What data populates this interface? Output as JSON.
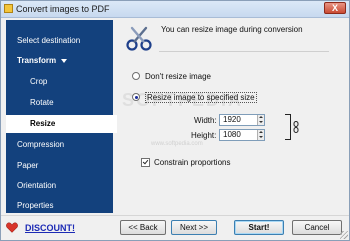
{
  "window": {
    "title": "Convert images to PDF",
    "close_label": "X"
  },
  "sidebar": {
    "items": [
      {
        "label": "Select destination"
      },
      {
        "label": "Transform"
      },
      {
        "label": "Crop"
      },
      {
        "label": "Rotate"
      },
      {
        "label": "Resize"
      },
      {
        "label": "Compression"
      },
      {
        "label": "Paper"
      },
      {
        "label": "Orientation"
      },
      {
        "label": "Properties"
      }
    ]
  },
  "main": {
    "header_text": "You can resize image during conversion",
    "option_dont_resize": "Don't resize image",
    "option_resize": "Resize image to specified size",
    "width_label": "Width:",
    "width_value": "1920",
    "height_label": "Height:",
    "height_value": "1080",
    "constrain_label": "Constrain proportions",
    "constrain_checked": true,
    "selected_option": "Resize image to specified size"
  },
  "watermark": {
    "text": "SOFTPEDIA",
    "url": "www.softpedia.com"
  },
  "footer": {
    "discount_label": "DISCOUNT!",
    "back_label": "<< Back",
    "next_label": "Next >>",
    "start_label": "Start!",
    "cancel_label": "Cancel"
  },
  "colors": {
    "sidebar_bg": "#13417d",
    "link": "#1c2ab5"
  }
}
